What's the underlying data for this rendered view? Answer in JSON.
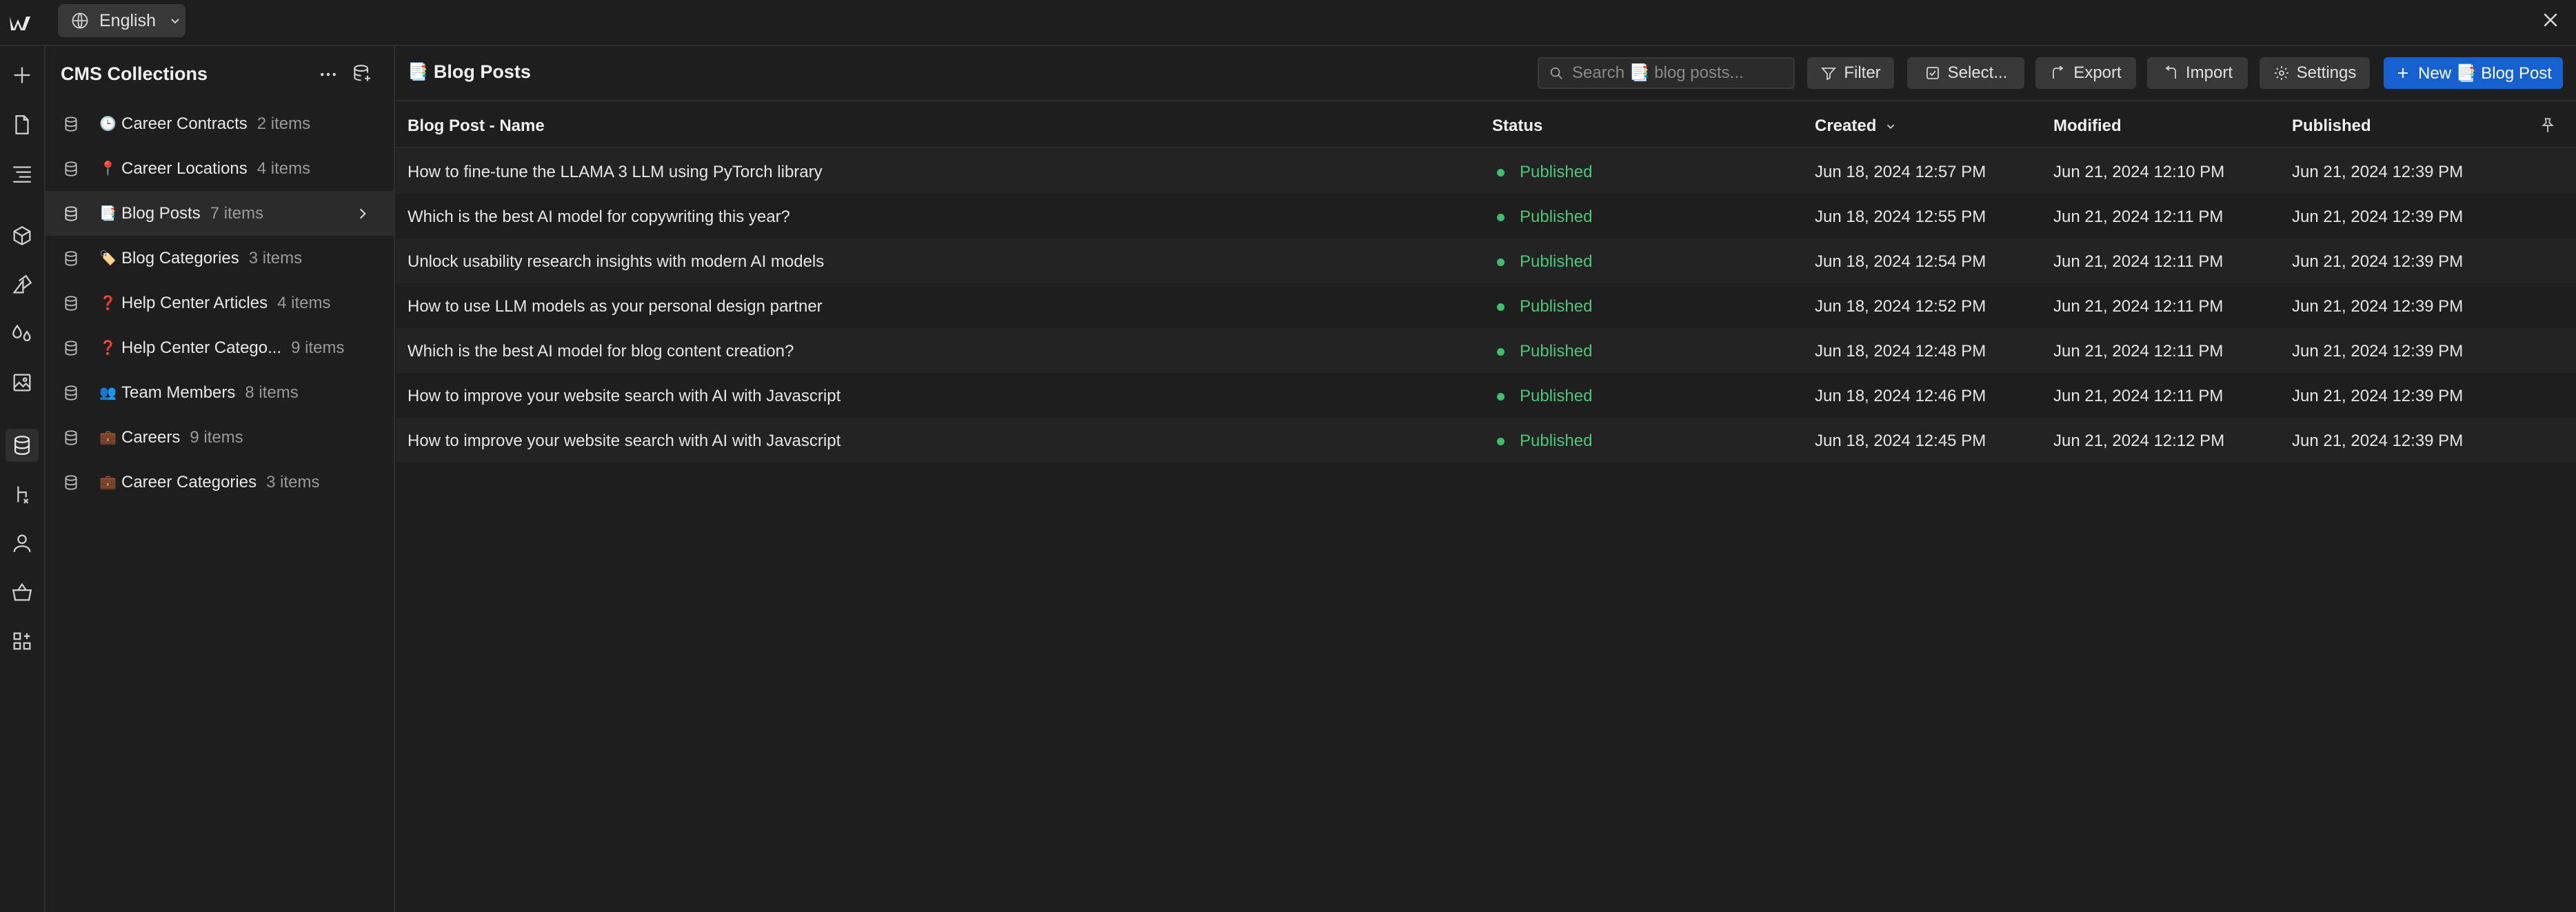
{
  "topbar": {
    "language": "English"
  },
  "sidebar": {
    "title": "CMS Collections",
    "items": [
      {
        "emoji": "🕒",
        "name": "Career Contracts",
        "count": "2 items"
      },
      {
        "emoji": "📍",
        "name": "Career Locations",
        "count": "4 items"
      },
      {
        "emoji": "📑",
        "name": "Blog Posts",
        "count": "7 items"
      },
      {
        "emoji": "🏷️",
        "name": "Blog Categories",
        "count": "3 items"
      },
      {
        "emoji": "❓",
        "name": "Help Center Articles",
        "count": "4 items"
      },
      {
        "emoji": "❓",
        "name": "Help Center Catego...",
        "count": "9 items"
      },
      {
        "emoji": "👥",
        "name": "Team Members",
        "count": "8 items"
      },
      {
        "emoji": "💼",
        "name": "Careers",
        "count": "9 items"
      },
      {
        "emoji": "💼",
        "name": "Career Categories",
        "count": "3 items"
      }
    ]
  },
  "main": {
    "title_emoji": "📑",
    "title": "Blog Posts",
    "search_placeholder": "Search 📑 blog posts...",
    "toolbar": {
      "filter": "Filter",
      "select": "Select...",
      "export": "Export",
      "import": "Import",
      "settings": "Settings",
      "new": "New 📑 Blog Post"
    },
    "columns": [
      "Blog Post - Name",
      "Status",
      "Created",
      "Modified",
      "Published"
    ],
    "rows": [
      {
        "name": "How to fine-tune the LLAMA 3 LLM using PyTorch library",
        "status": "Published",
        "created": "Jun 18, 2024 12:57 PM",
        "modified": "Jun 21, 2024 12:10 PM",
        "published": "Jun 21, 2024 12:39 PM"
      },
      {
        "name": "Which is the best AI model for copywriting this year?",
        "status": "Published",
        "created": "Jun 18, 2024 12:55 PM",
        "modified": "Jun 21, 2024 12:11 PM",
        "published": "Jun 21, 2024 12:39 PM"
      },
      {
        "name": "Unlock usability research insights with modern AI models",
        "status": "Published",
        "created": "Jun 18, 2024 12:54 PM",
        "modified": "Jun 21, 2024 12:11 PM",
        "published": "Jun 21, 2024 12:39 PM"
      },
      {
        "name": "How to use LLM models as your personal design partner",
        "status": "Published",
        "created": "Jun 18, 2024 12:52 PM",
        "modified": "Jun 21, 2024 12:11 PM",
        "published": "Jun 21, 2024 12:39 PM"
      },
      {
        "name": "Which is the best AI model for blog content creation?",
        "status": "Published",
        "created": "Jun 18, 2024 12:48 PM",
        "modified": "Jun 21, 2024 12:11 PM",
        "published": "Jun 21, 2024 12:39 PM"
      },
      {
        "name": "How to improve your website search with AI with Javascript",
        "status": "Published",
        "created": "Jun 18, 2024 12:46 PM",
        "modified": "Jun 21, 2024 12:11 PM",
        "published": "Jun 21, 2024 12:39 PM"
      },
      {
        "name": "How to improve your website search with AI with Javascript",
        "status": "Published",
        "created": "Jun 18, 2024 12:45 PM",
        "modified": "Jun 21, 2024 12:12 PM",
        "published": "Jun 21, 2024 12:39 PM"
      }
    ]
  },
  "colors": {
    "accent": "#1660cf",
    "published": "#4fc57b"
  }
}
